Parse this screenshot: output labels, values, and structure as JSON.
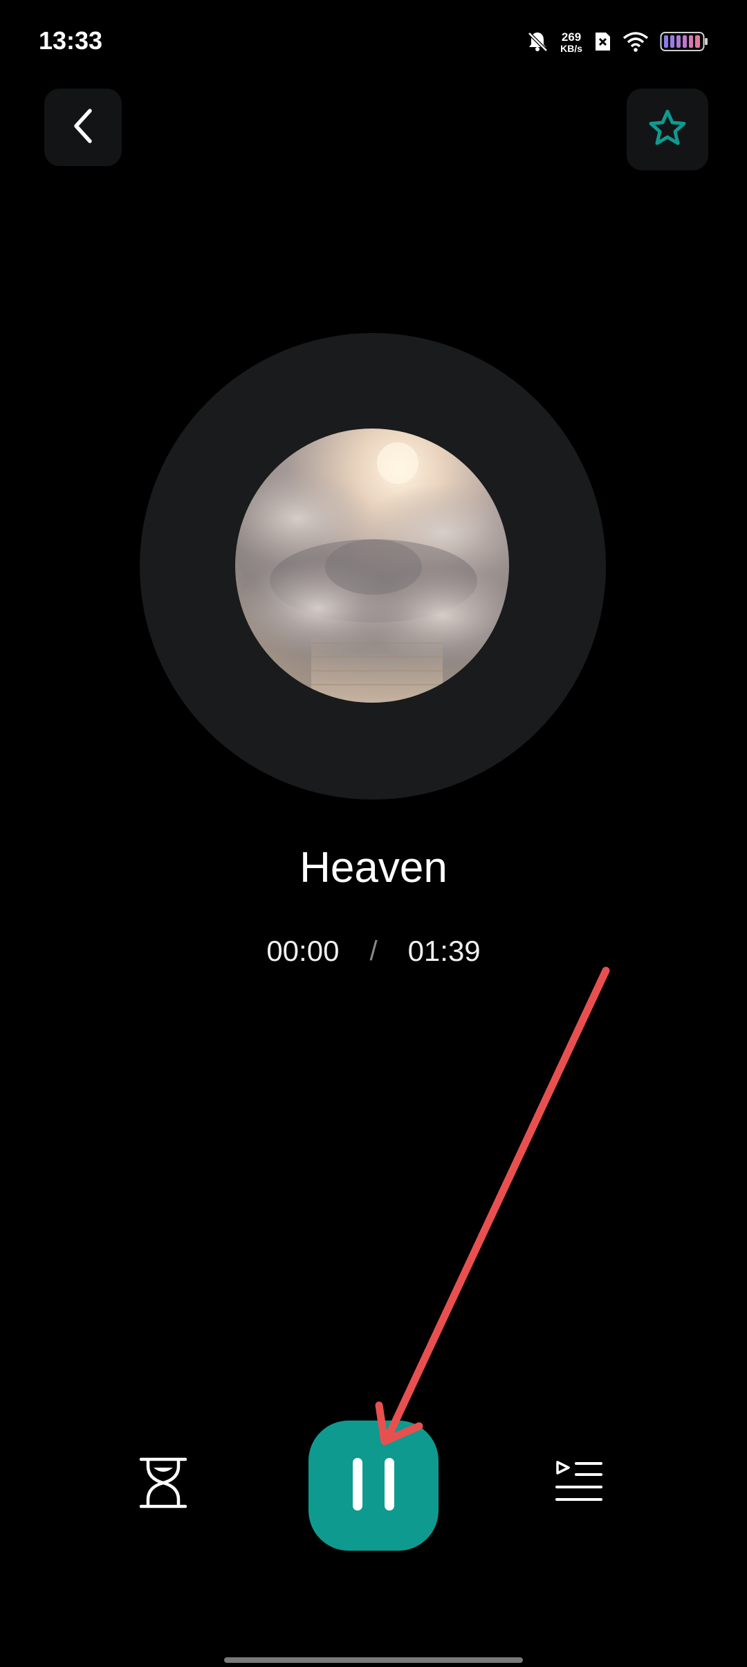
{
  "status_bar": {
    "time": "13:33",
    "speed_value": "269",
    "speed_unit": "KB/s",
    "icons": [
      "bell-muted-icon",
      "sim-none-icon",
      "wifi-icon",
      "battery-icon"
    ]
  },
  "header": {
    "back_icon": "chevron-left-icon",
    "favorite_icon": "star-outline-icon"
  },
  "player": {
    "title": "Heaven",
    "current_time": "00:00",
    "separator": "/",
    "total_time": "01:39",
    "state": "playing"
  },
  "controls": {
    "timer_icon": "hourglass-icon",
    "pause_icon": "pause-icon",
    "playlist_icon": "playlist-icon"
  },
  "colors": {
    "accent": "#0e9a8f",
    "background": "#000000",
    "disc": "#191b1c",
    "button_bg": "#131416",
    "annotation_arrow": "#e85050"
  }
}
